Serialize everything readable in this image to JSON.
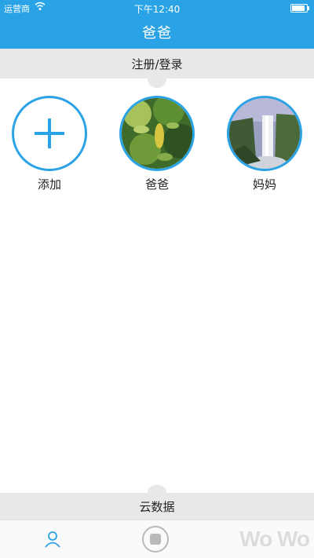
{
  "status_bar": {
    "carrier": "运营商",
    "time": "下午12:40",
    "battery_level": 0.9
  },
  "nav": {
    "title": "爸爸"
  },
  "login_bar": {
    "label": "注册/登录"
  },
  "profiles": [
    {
      "label": "添加",
      "icon": "plus-icon"
    },
    {
      "label": "爸爸",
      "icon": "forest-photo"
    },
    {
      "label": "妈妈",
      "icon": "waterfall-photo"
    }
  ],
  "cloud_bar": {
    "label": "云数据"
  },
  "tabbar": {
    "items": [
      {
        "icon": "user-icon"
      },
      {
        "icon": "record-icon"
      }
    ]
  },
  "watermark": {
    "text": "Wo Wo"
  },
  "colors": {
    "accent": "#2aa3e6",
    "section_bg": "#e8e8e8",
    "tab_icon": "#b9b9b9"
  }
}
